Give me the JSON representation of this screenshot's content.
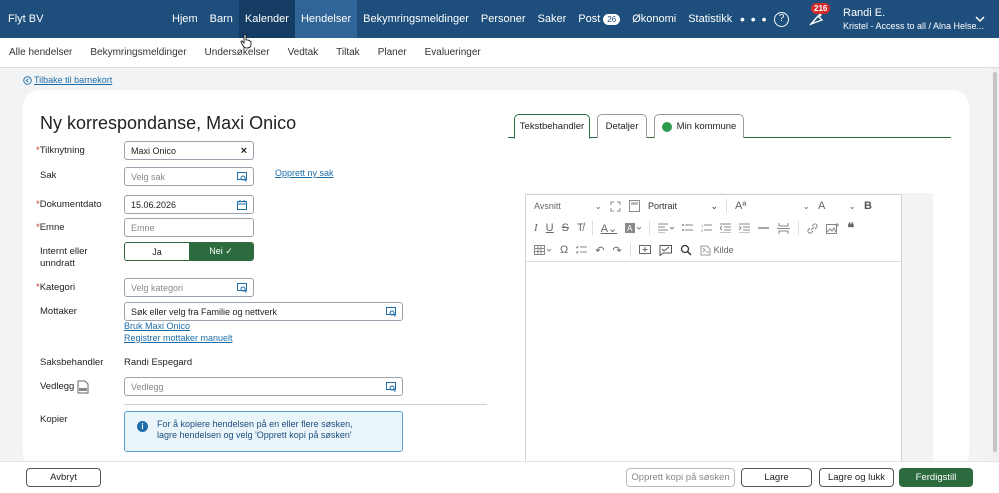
{
  "header": {
    "brand": "Flyt BV",
    "nav": [
      {
        "label": "Hjem"
      },
      {
        "label": "Barn"
      },
      {
        "label": "Kalender"
      },
      {
        "label": "Hendelser"
      },
      {
        "label": "Bekymringsmeldinger"
      },
      {
        "label": "Personer"
      },
      {
        "label": "Saker"
      },
      {
        "label": "Post"
      },
      {
        "label": "Økonomi"
      },
      {
        "label": "Statistikk"
      }
    ],
    "post_count": "26",
    "more_label": "• • •",
    "help_label": "?",
    "notification_count": "216",
    "user_name": "Randi E.",
    "user_role": "Kristel - Access to all / Alna Helse..."
  },
  "subnav": [
    "Alle hendelser",
    "Bekymringsmeldinger",
    "Undersøkelser",
    "Vedtak",
    "Tiltak",
    "Planer",
    "Evalueringer"
  ],
  "back_link": "Tilbake til barnekort",
  "form": {
    "title": "Ny korrespondanse, Maxi Onico",
    "tilknytning_label": "Tilknytning",
    "tilknytning_value": "Maxi Onico",
    "sak_label": "Sak",
    "sak_placeholder": "Velg sak",
    "opprett_sak_link": "Opprett ny sak",
    "dokumentdato_label": "Dokumentdato",
    "dokumentdato_value": "15.06.2026",
    "emne_label": "Emne",
    "emne_placeholder": "Emne",
    "internt_label_1": "Internt eller",
    "internt_label_2": "unndratt",
    "toggle_ja": "Ja",
    "toggle_nei": "Nei ✓",
    "kategori_label": "Kategori",
    "kategori_placeholder": "Velg kategori",
    "mottaker_label": "Mottaker",
    "mottaker_placeholder": "Søk eller velg fra Familie og nettverk",
    "bruk_link": "Bruk Maxi Onico",
    "registrer_link": "Registrer mottaker manuelt",
    "saksbehandler_label": "Saksbehandler",
    "saksbehandler_value": "Randi Espegard",
    "vedlegg_label": "Vedlegg",
    "vedlegg_placeholder": "Vedlegg",
    "kopier_label": "Kopier",
    "info_line_1": "For å kopiere hendelsen på en eller flere søsken,",
    "info_line_2": "lagre hendelsen og velg 'Opprett kopi på søsken'",
    "required_mark": "*",
    "clear_mark": "×"
  },
  "tabs": [
    "Tekstbehandler",
    "Detaljer",
    "Min kommune"
  ],
  "editor": {
    "paragraph_select": "Avsnitt",
    "orientation_select": "Portrait",
    "font_size_label": "A",
    "kilde_label": "Kilde"
  },
  "buttons": {
    "cancel": "Avbryt",
    "copy_siblings": "Opprett kopi på søsken",
    "save": "Lagre",
    "save_close": "Lagre og lukk",
    "finish": "Ferdigstill"
  },
  "colors": {
    "header_bg": "#1d4e7c",
    "accent_green": "#2c6b3e",
    "link_blue": "#1d6ea8",
    "notification_red": "#d42d2d"
  }
}
